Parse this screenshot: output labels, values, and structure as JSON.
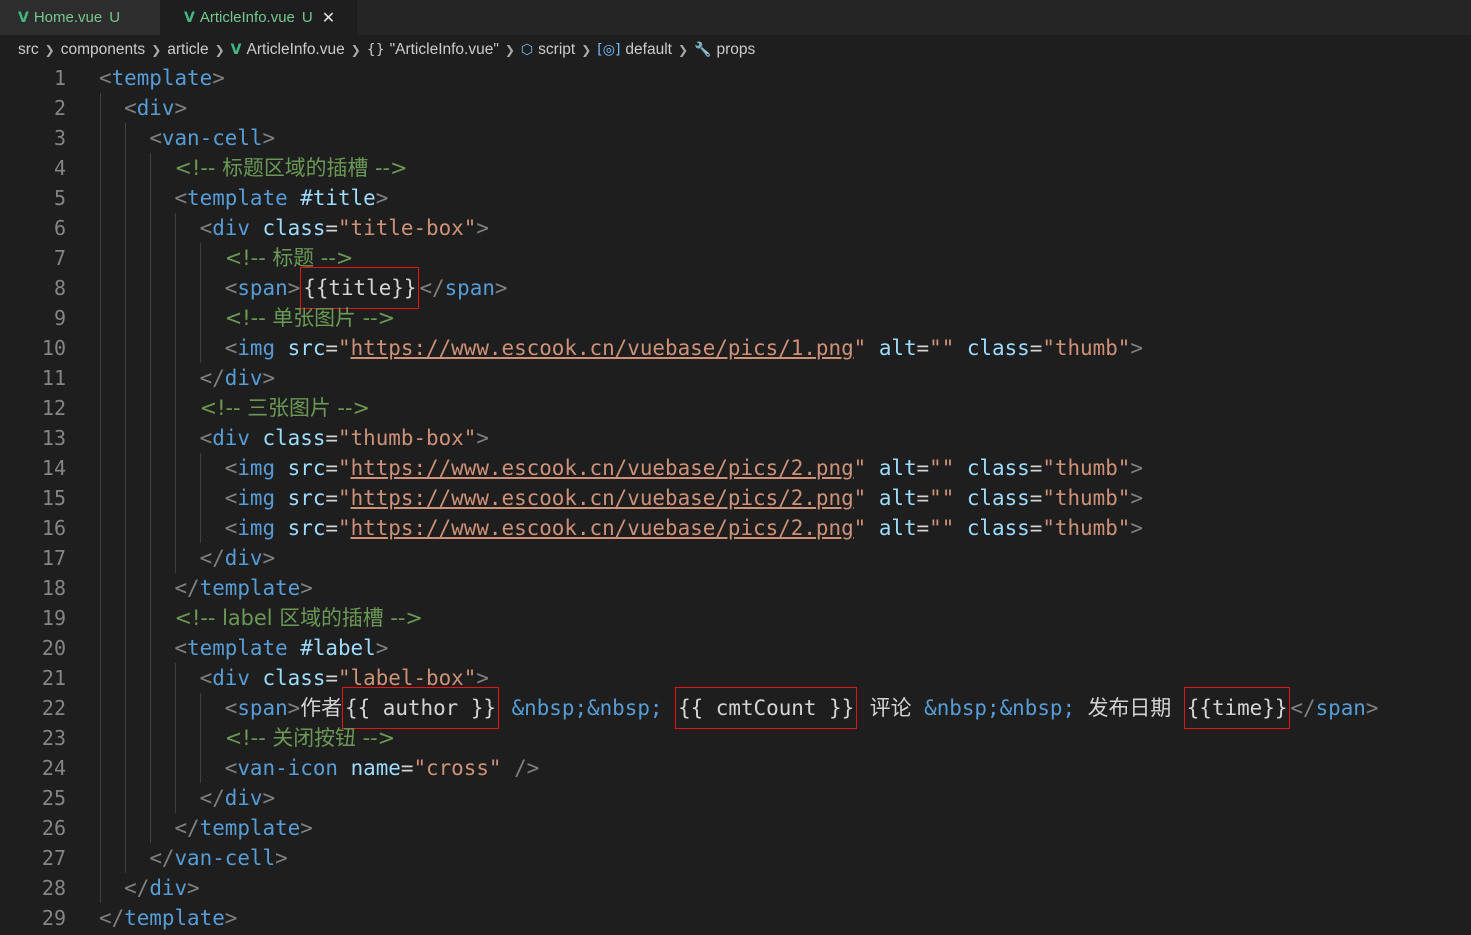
{
  "tabs": [
    {
      "name": "Home.vue",
      "status": "U",
      "active": false
    },
    {
      "name": "ArticleInfo.vue",
      "status": "U",
      "active": true,
      "close": "✕"
    }
  ],
  "breadcrumb": [
    "src",
    "components",
    "article",
    "ArticleInfo.vue",
    "\"ArticleInfo.vue\"",
    "script",
    "default",
    "props"
  ],
  "line_numbers": [
    "1",
    "2",
    "3",
    "4",
    "5",
    "6",
    "7",
    "8",
    "9",
    "10",
    "11",
    "12",
    "13",
    "14",
    "15",
    "16",
    "17",
    "18",
    "19",
    "20",
    "21",
    "22",
    "23",
    "24",
    "25",
    "26",
    "27",
    "28",
    "29"
  ],
  "code": {
    "l1": "template",
    "l2": "div",
    "l3": "van-cell",
    "l4": "<!-- 标题区域的插槽 -->",
    "l5_tag": "template",
    "l5_attr": "#title",
    "l6_tag": "div",
    "l6_attr": "class",
    "l6_val": "\"title-box\"",
    "l7": "<!-- 标题 -->",
    "l8_tag": "span",
    "l8_expr": "{{title}}",
    "l9": "<!-- 单张图片 -->",
    "img_tag": "img",
    "src_attr": "src",
    "alt_attr": "alt",
    "class_attr": "class",
    "l10_url": "https://www.escook.cn/vuebase/pics/1.png",
    "l13_url": "https://www.escook.cn/vuebase/pics/2.png",
    "alt_val": "\"\"",
    "thumb_val": "\"thumb\"",
    "l11": "div",
    "l12": "<!-- 三张图片 -->",
    "l13_tag": "div",
    "l13_val": "\"thumb-box\"",
    "l18": "template",
    "l19": "<!-- label 区域的插槽 -->",
    "l20_tag": "template",
    "l20_attr": "#label",
    "l21_val": "\"label-box\"",
    "l22_text1": "作者",
    "l22_author": "{{ author }}",
    "l22_nbsp": "&nbsp;&nbsp;",
    "l22_cmt": "{{ cmtCount }}",
    "l22_text2": "评论",
    "l22_text3": "发布日期",
    "l22_time": "{{time}}",
    "l23": "<!-- 关闭按钮 -->",
    "l24_tag": "van-icon",
    "l24_attr": "name",
    "l24_val": "\"cross\""
  },
  "colors": {
    "background": "#1e1e1e",
    "tag": "#569cd6",
    "attribute": "#9cdcfe",
    "string": "#ce9178",
    "comment": "#6a9955",
    "highlight_box": "#e51414"
  }
}
